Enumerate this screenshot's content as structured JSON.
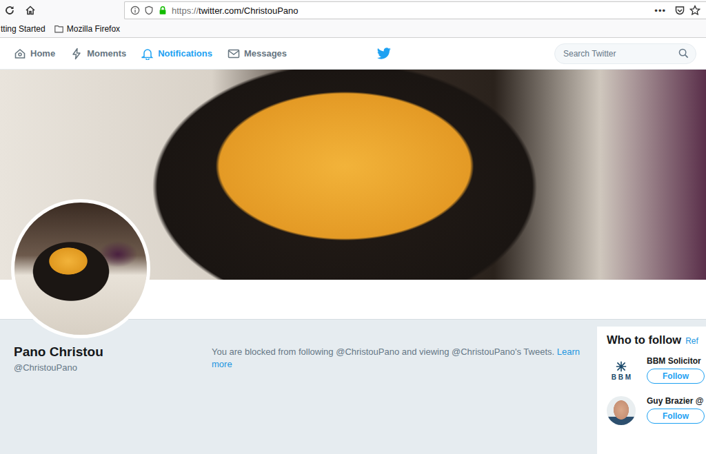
{
  "browser": {
    "url_scheme": "https://",
    "url_rest": "twitter.com/ChristouPano",
    "menu": "•••",
    "bookmarks": [
      {
        "label": "tting Started",
        "kind": "page"
      },
      {
        "label": "Mozilla Firefox",
        "kind": "folder"
      }
    ]
  },
  "nav": {
    "items": [
      {
        "label": "Home",
        "selected": false
      },
      {
        "label": "Moments",
        "selected": false
      },
      {
        "label": "Notifications",
        "selected": true
      },
      {
        "label": "Messages",
        "selected": false
      }
    ],
    "search": {
      "placeholder": "Search Twitter"
    }
  },
  "profile": {
    "name": "Pano Christou",
    "handle": "@ChristouPano"
  },
  "notice": {
    "text": "You are blocked from following @ChristouPano and viewing @ChristouPano's Tweets.",
    "link": "Learn more"
  },
  "who_to_follow": {
    "title": "Who to follow",
    "refresh": "Ref",
    "accounts": [
      {
        "name": "BBM Solicitor",
        "kind": "logo",
        "logo_text": "B B M",
        "button": "Follow"
      },
      {
        "name": "Guy Brazier @",
        "kind": "photo",
        "button": "Follow"
      }
    ]
  }
}
